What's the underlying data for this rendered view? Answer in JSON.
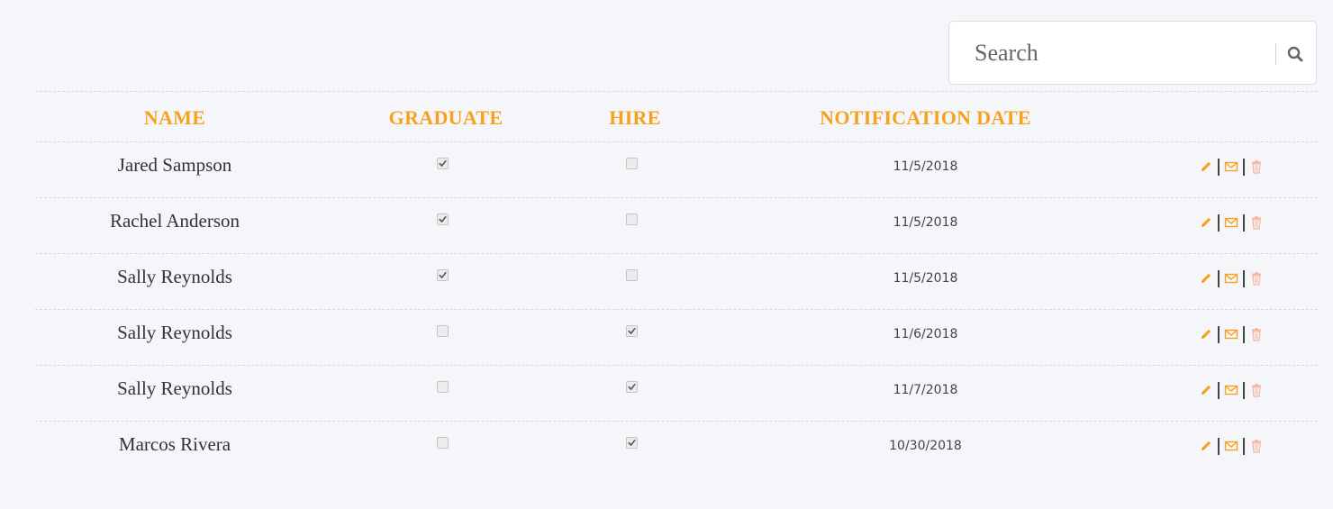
{
  "search": {
    "placeholder": "Search",
    "icon": "search-icon"
  },
  "table": {
    "columns": [
      {
        "key": "name",
        "label": "NAME"
      },
      {
        "key": "graduate",
        "label": "GRADUATE"
      },
      {
        "key": "hire",
        "label": "HIRE"
      },
      {
        "key": "notification_date",
        "label": "NOTIFICATION DATE"
      },
      {
        "key": "actions",
        "label": ""
      }
    ],
    "rows": [
      {
        "name": "Jared Sampson",
        "graduate": true,
        "hire": false,
        "notification_date": "11/5/2018"
      },
      {
        "name": "Rachel Anderson",
        "graduate": true,
        "hire": false,
        "notification_date": "11/5/2018"
      },
      {
        "name": "Sally Reynolds",
        "graduate": true,
        "hire": false,
        "notification_date": "11/5/2018"
      },
      {
        "name": "Sally Reynolds",
        "graduate": false,
        "hire": true,
        "notification_date": "11/6/2018"
      },
      {
        "name": "Sally Reynolds",
        "graduate": false,
        "hire": true,
        "notification_date": "11/7/2018"
      },
      {
        "name": "Marcos Rivera",
        "graduate": false,
        "hire": true,
        "notification_date": "10/30/2018"
      }
    ],
    "row_actions": [
      {
        "icon": "pencil-icon",
        "action": "edit"
      },
      {
        "icon": "envelope-icon",
        "action": "email"
      },
      {
        "icon": "trash-icon",
        "action": "delete"
      }
    ]
  },
  "colors": {
    "accent": "#f7a21e",
    "edit": "#f7a21e",
    "email": "#f7a21e",
    "delete": "#f7b29a",
    "background": "#f5f6fa"
  }
}
